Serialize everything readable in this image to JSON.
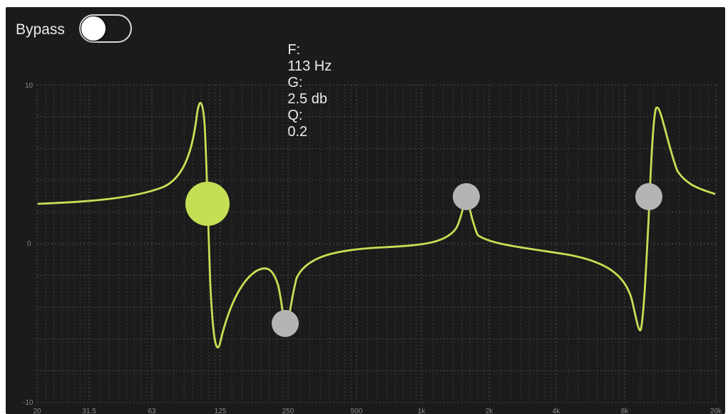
{
  "bypass": {
    "label": "Bypass",
    "enabled": false
  },
  "readout": {
    "f_label": "F:",
    "f_value": "113 Hz",
    "g_label": "G:",
    "g_value": "2.5 db",
    "q_label": "Q:",
    "q_value": "0.2"
  },
  "graph": {
    "y_ticks": [
      "10",
      "0",
      "-10"
    ],
    "x_ticks": [
      "20",
      "31.5",
      "63",
      "125",
      "250",
      "500",
      "1k",
      "2k",
      "4k",
      "8k",
      "20k"
    ],
    "curve_color": "#c9de54",
    "handle_active_color": "#c4df54",
    "handle_inactive_color": "#b4b4b4",
    "grid_color": "#4a4a4a",
    "background": "#1b1b1b"
  }
}
